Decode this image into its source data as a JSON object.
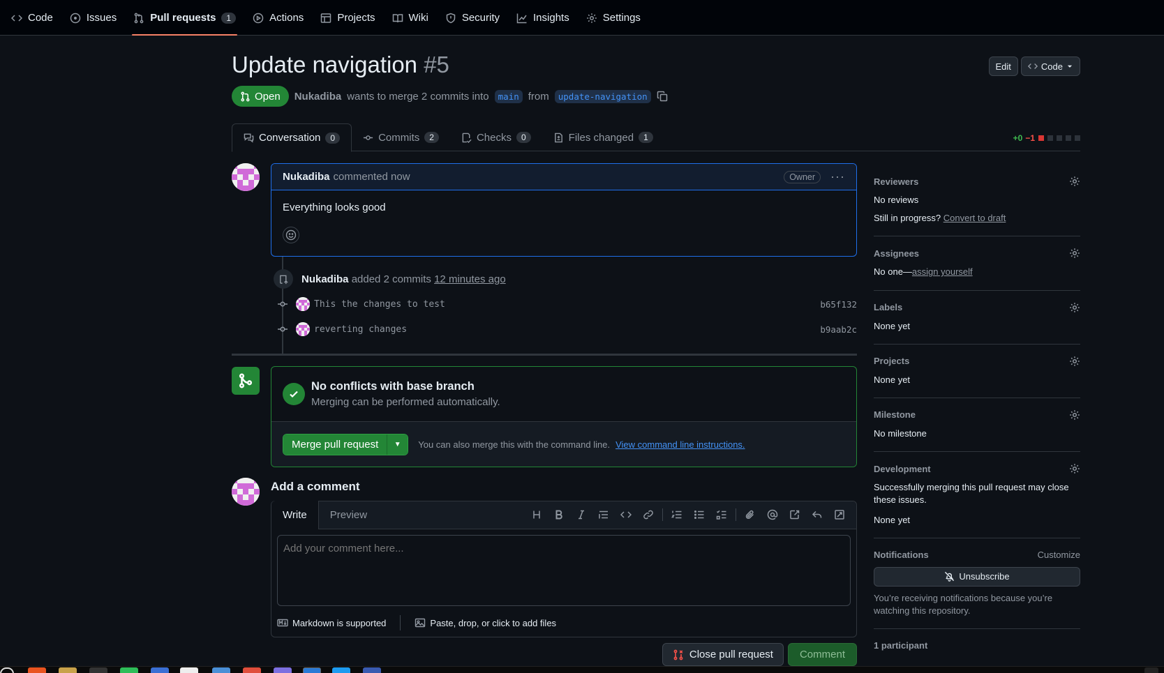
{
  "nav": {
    "items": [
      {
        "label": "Code",
        "icon": "code-icon"
      },
      {
        "label": "Issues",
        "icon": "issue-icon"
      },
      {
        "label": "Pull requests",
        "icon": "pull-request-icon",
        "count": "1"
      },
      {
        "label": "Actions",
        "icon": "play-icon"
      },
      {
        "label": "Projects",
        "icon": "table-icon"
      },
      {
        "label": "Wiki",
        "icon": "book-icon"
      },
      {
        "label": "Security",
        "icon": "shield-icon"
      },
      {
        "label": "Insights",
        "icon": "graph-icon"
      },
      {
        "label": "Settings",
        "icon": "gear-icon"
      }
    ]
  },
  "pr": {
    "title": "Update navigation",
    "number": "#5",
    "state": "Open",
    "author": "Nukadiba",
    "merge_text_1": "wants to merge 2 commits into",
    "base_branch": "main",
    "merge_text_2": "from",
    "head_branch": "update-navigation"
  },
  "header_buttons": {
    "edit": "Edit",
    "code": "Code"
  },
  "tabs": [
    {
      "label": "Conversation",
      "count": "0"
    },
    {
      "label": "Commits",
      "count": "2"
    },
    {
      "label": "Checks",
      "count": "0"
    },
    {
      "label": "Files changed",
      "count": "1"
    }
  ],
  "diffstat": {
    "additions": "+0",
    "deletions": "−1"
  },
  "comment": {
    "author": "Nukadiba",
    "action": "commented now",
    "role": "Owner",
    "body": "Everything looks good"
  },
  "commit_event": {
    "author": "Nukadiba",
    "action": "added 2 commits",
    "time": "12 minutes ago",
    "commits": [
      {
        "message": "This the changes to test",
        "sha": "b65f132"
      },
      {
        "message": "reverting changes",
        "sha": "b9aab2c"
      }
    ]
  },
  "merge": {
    "title": "No conflicts with base branch",
    "subtitle": "Merging can be performed automatically.",
    "button": "Merge pull request",
    "hint": "You can also merge this with the command line.",
    "link": "View command line instructions."
  },
  "add_comment": {
    "title": "Add a comment",
    "tab_write": "Write",
    "tab_preview": "Preview",
    "placeholder": "Add your comment here...",
    "markdown_note": "Markdown is supported",
    "files_note": "Paste, drop, or click to add files"
  },
  "actions": {
    "close": "Close pull request",
    "comment": "Comment"
  },
  "sidebar": {
    "reviewers": {
      "title": "Reviewers",
      "value": "No reviews",
      "draft_prefix": "Still in progress?",
      "draft_link": "Convert to draft"
    },
    "assignees": {
      "title": "Assignees",
      "prefix": "No one—",
      "link": "assign yourself"
    },
    "labels": {
      "title": "Labels",
      "value": "None yet"
    },
    "projects": {
      "title": "Projects",
      "value": "None yet"
    },
    "milestone": {
      "title": "Milestone",
      "value": "No milestone"
    },
    "development": {
      "title": "Development",
      "desc": "Successfully merging this pull request may close these issues.",
      "value": "None yet"
    },
    "notifications": {
      "title": "Notifications",
      "customize": "Customize",
      "button": "Unsubscribe",
      "desc": "You’re receiving notifications because you’re watching this repository."
    },
    "participants": {
      "title": "1 participant"
    }
  },
  "colors": {
    "accent_green": "#238636",
    "accent_blue": "#4493f8",
    "tab_underline": "#f78166",
    "bg": "#0d1117"
  }
}
